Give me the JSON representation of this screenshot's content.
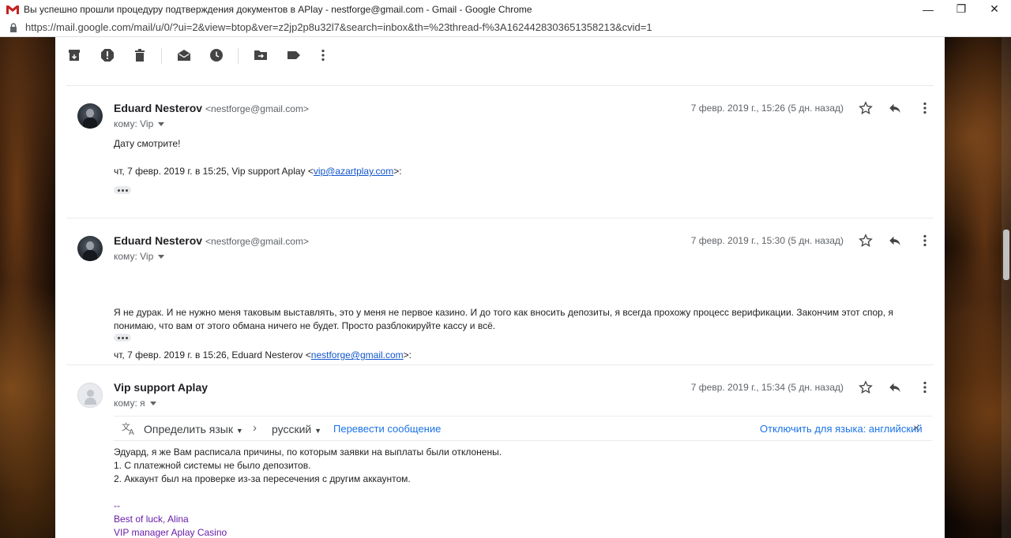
{
  "window": {
    "title": "Вы успешно прошли процедуру подтверждения документов в APlay - nestforge@gmail.com - Gmail - Google Chrome",
    "controls": {
      "minimize": "—",
      "maximize": "❐",
      "close": "✕"
    }
  },
  "address_bar": {
    "url": "https://mail.google.com/mail/u/0/?ui=2&view=btop&ver=z2jp2p8u32l7&search=inbox&th=%23thread-f%3A1624428303651358213&cvid=1"
  },
  "toolbar": {
    "icons": [
      "archive-icon",
      "report-spam-icon",
      "delete-icon",
      "mark-unread-icon",
      "snooze-icon",
      "move-to-icon",
      "label-icon",
      "more-icon"
    ]
  },
  "messages": [
    {
      "sender": "Eduard Nesterov",
      "email": "<nestforge@gmail.com>",
      "to": "кому: Vip",
      "date": "7 февр. 2019 г., 15:26 (5 дн. назад)",
      "body": "Дату смотрите!",
      "quote_prefix": "чт, 7 февр. 2019 г. в 15:25, Vip support Aplay <",
      "quote_link": "vip@azartplay.com",
      "quote_suffix": ">:"
    },
    {
      "sender": "Eduard Nesterov",
      "email": "<nestforge@gmail.com>",
      "to": "кому: Vip",
      "date": "7 февр. 2019 г., 15:30 (5 дн. назад)",
      "body": "Я не дурак. И не нужно  меня таковым выставлять, это у меня не первое казино. И до того как вносить депозиты, я всегда прохожу процесс верификации. Закончим этот спор, я понимаю, что вам от этого обмана ничего не будет. Просто разблокируйте кассу и всё.",
      "quote_prefix": "чт, 7 февр. 2019 г. в 15:26, Eduard Nesterov <",
      "quote_link": "nestforge@gmail.com",
      "quote_suffix": ">:"
    },
    {
      "sender": "Vip support Aplay",
      "to": "кому: я",
      "date": "7 февр. 2019 г., 15:34 (5 дн. назад)",
      "translate": {
        "detect": "Определить язык",
        "arrow": "›",
        "target": "русский",
        "action": "Перевести сообщение",
        "disable": "Отключить для языка: английский",
        "close": "×"
      },
      "body_lines": [
        " Эдуард, я же Вам расписала причины, по которым заявки на выплаты были отклонены.",
        "1. С платежной системы не было депозитов.",
        "2. Аккаунт был на проверке из-за пересечения с другим аккаунтом."
      ],
      "signature": [
        "--",
        "Best of luck, Alina",
        "VIP manager Aplay Casino"
      ]
    }
  ]
}
